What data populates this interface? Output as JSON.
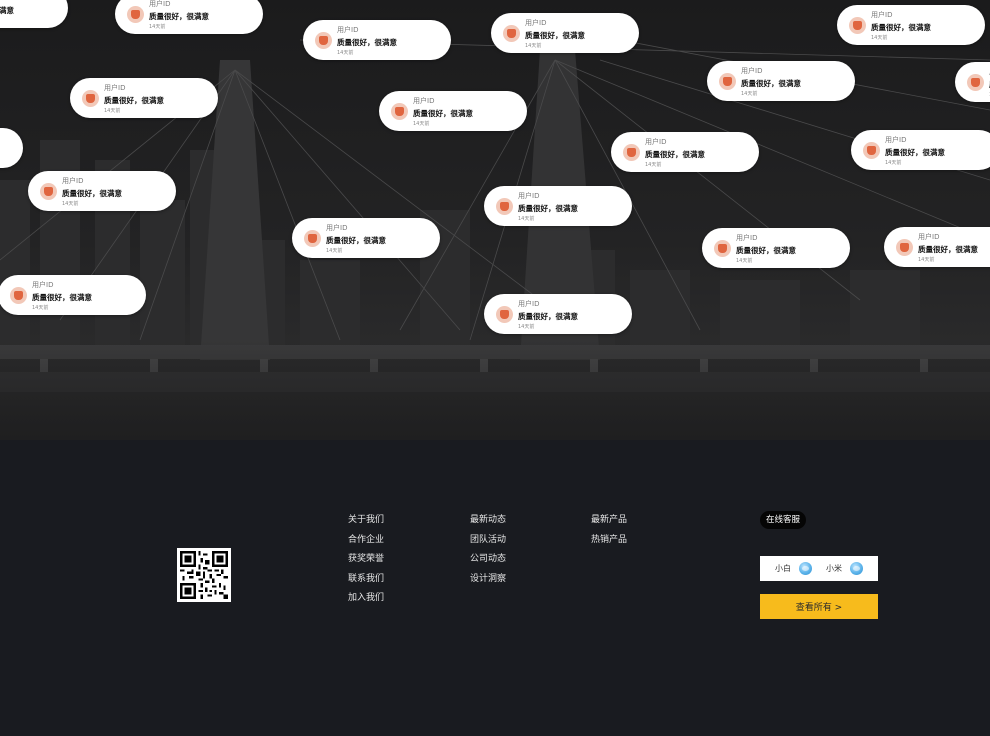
{
  "reviews": {
    "user_label": "用户ID",
    "message": "质量很好，很满意",
    "time": "14天前"
  },
  "footer": {
    "columns": [
      [
        "关于我们",
        "合作企业",
        "获奖荣誉",
        "联系我们",
        "加入我们"
      ],
      [
        "最新动态",
        "团队活动",
        "公司动态",
        "设计洞察"
      ],
      [
        "最新产品",
        "热销产品"
      ]
    ],
    "service_title": "在线客服",
    "agents": [
      "小白",
      "小米"
    ],
    "view_all": "查看所有 >"
  },
  "colors": {
    "accent": "#f7bb1c",
    "footer_bg": "#191b20"
  }
}
